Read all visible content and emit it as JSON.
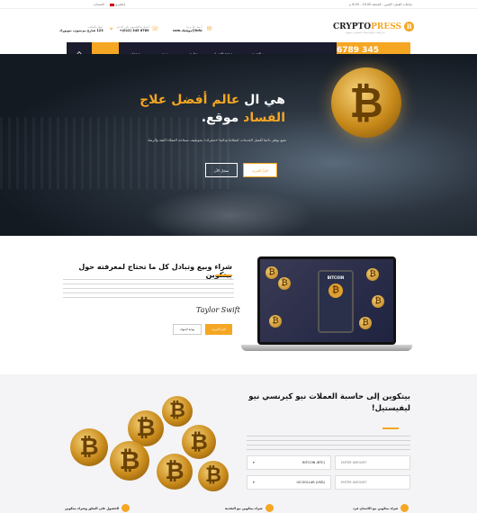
{
  "topbar": {
    "hours": "ساعات العمل: الإثنين - الجمعة 10.00 - 6.00 م",
    "lang": "إنجليزي",
    "account": "الحساب"
  },
  "header": {
    "logo_main": "CRYPTO",
    "logo_accent": "PRESS",
    "logo_tagline": "قم بإنشاء مواقع العملات المشفرة بسهولة",
    "contact_email": {
      "title": "أرسل لنا بريدا",
      "value": "info@موقعك.com"
    },
    "contact_phone": {
      "title": "اتصل بنا للحصول على الدعم",
      "value": "6789 345 (012)+"
    },
    "contact_address": {
      "title": "عنوان المكتب",
      "value": "123 شارع بيرسون، نيويورك"
    }
  },
  "nav": {
    "active": "الرئيسية",
    "items": [
      "صفحات",
      "مدونة",
      "تطبيق",
      "صفحة الخدمات",
      "رمز الخدمة"
    ],
    "phone": "6789 345 (012)+"
  },
  "hero": {
    "title_part1": "هي ال",
    "title_highlight1": "عالم",
    "title_highlight2": "أفضل علاج الفساد",
    "title_part2": "موقع.",
    "subtitle": "نقيع بوقتر دائما أفضل الخدمات لعملائنا ودائما «شغرك» بجونقيف سماحة العملاء الثقة والرضا.",
    "btn_primary": "اقرأ المزيد",
    "btn_secondary": "سجل الآن"
  },
  "about": {
    "title": "شراء وبيع وتبادل كل ما تحتاج لمعرفته حول بيتكوين",
    "signature": "Taylor Swift",
    "btn_primary": "اقرأ المزيد",
    "btn_secondary": "بوابة البنوك",
    "phone_label": "BITCOIN"
  },
  "converter": {
    "title": "بيتكوين إلى حاسبة العملات نيو كيرنسي نيو ليفيستيل!",
    "field1_placeholder": "ENTER AMOUNT",
    "field1_select": "BITCOIN (BTC)",
    "field2_placeholder": "ENTER AMOUNT",
    "field2_select": "US DOLLAR (USD)"
  },
  "features": [
    "شراء بيتكوين مع الائتمان فرد",
    "شراء بيتكوين مع النقدية",
    "الحصول على التعلق وشراء بيتكوين"
  ],
  "colors": {
    "accent": "#f5a623",
    "nav": "#1b1c2e"
  }
}
